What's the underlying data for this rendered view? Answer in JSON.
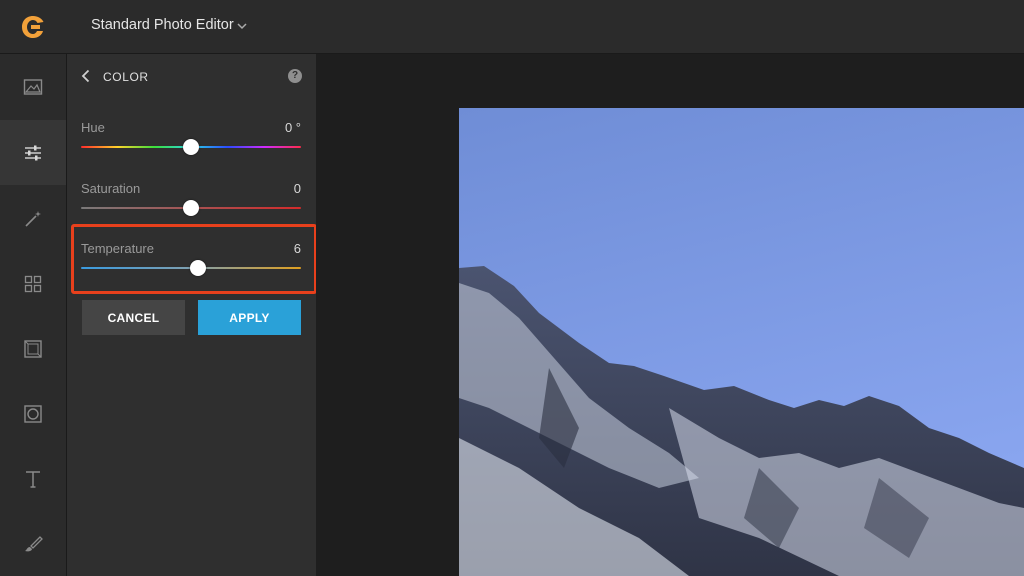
{
  "header": {
    "app_title": "Standard Photo Editor",
    "brand_color": "#f2a13a"
  },
  "rail": {
    "items": [
      {
        "icon": "image-icon"
      },
      {
        "icon": "sliders-icon",
        "active": true
      },
      {
        "icon": "magic-wand-icon"
      },
      {
        "icon": "grid-icon"
      },
      {
        "icon": "frame-icon"
      },
      {
        "icon": "vignette-icon"
      },
      {
        "icon": "text-icon"
      },
      {
        "icon": "brush-icon"
      }
    ]
  },
  "panel": {
    "title": "COLOR",
    "help_symbol": "?",
    "sliders": [
      {
        "label": "Hue",
        "value": "0 °",
        "position": 0.5
      },
      {
        "label": "Saturation",
        "value": "0",
        "position": 0.5
      },
      {
        "label": "Temperature",
        "value": "6",
        "position": 0.53
      }
    ],
    "highlight_color": "#e8401c"
  },
  "actions": {
    "cancel_label": "CANCEL",
    "apply_label": "APPLY",
    "apply_color": "#2aa1d8"
  }
}
